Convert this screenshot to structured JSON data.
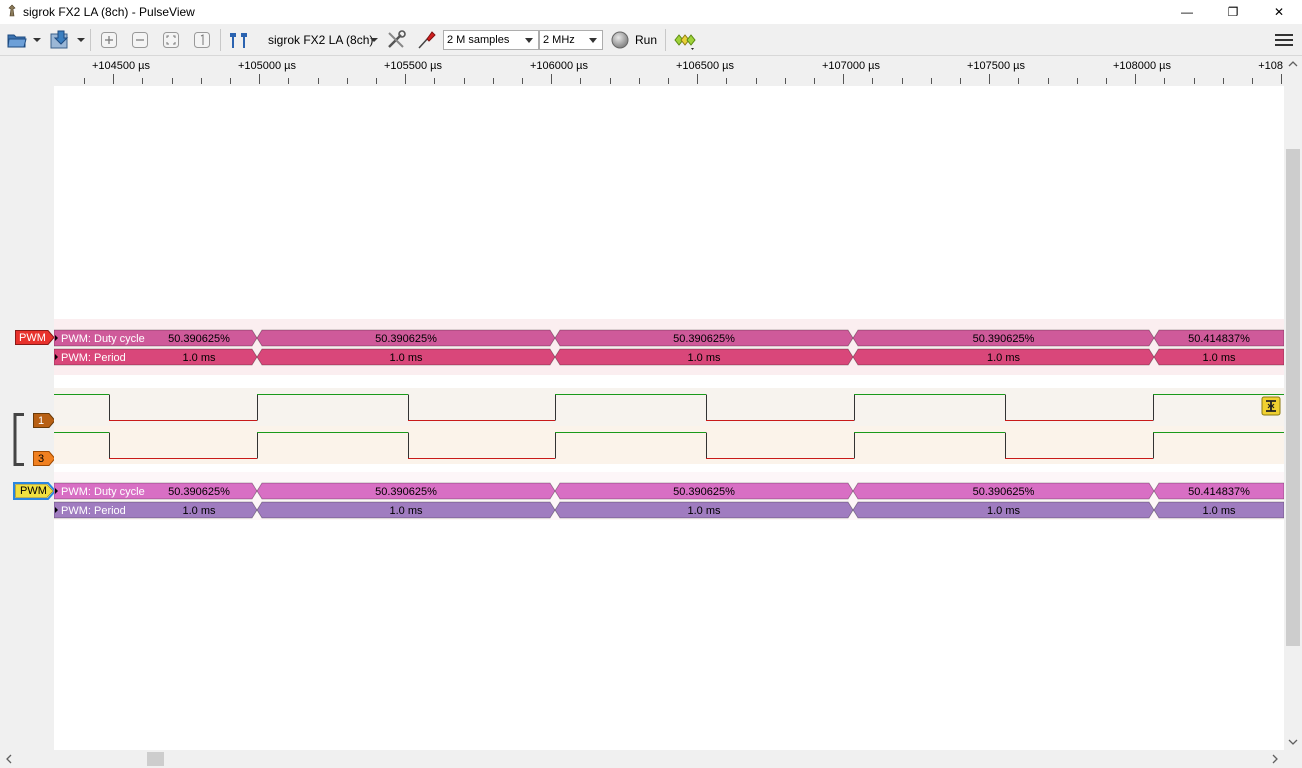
{
  "window": {
    "title": "sigrok FX2 LA (8ch) - PulseView",
    "minimize": "—",
    "maximize": "❐",
    "close": "✕"
  },
  "toolbar": {
    "device": "sigrok FX2 LA (8ch)",
    "samples": "2 M samples",
    "samplerate": "2 MHz",
    "run_label": "Run"
  },
  "ruler": {
    "labels": [
      "+104500 µs",
      "+105000 µs",
      "+105500 µs",
      "+106000 µs",
      "+106500 µs",
      "+107000 µs",
      "+107500 µs",
      "+108000 µs",
      "+108"
    ]
  },
  "traces": {
    "decoder1": {
      "tag": "PWM",
      "tag_color": "#e8322c",
      "duty_row_label": "PWM: Duty cycle",
      "period_row_label": "PWM: Period",
      "duty_color": "#cf5a9a",
      "period_color": "#d9477a",
      "duty_values": [
        "50.390625%",
        "50.390625%",
        "50.390625%",
        "50.390625%",
        "50.414837%"
      ],
      "period_values": [
        "1.0 ms",
        "1.0 ms",
        "1.0 ms",
        "1.0 ms",
        "1.0 ms"
      ]
    },
    "channels": [
      {
        "tag": "1",
        "color": "#b86014"
      },
      {
        "tag": "3",
        "color": "#f08020"
      }
    ],
    "decoder2": {
      "tag": "PWM",
      "tag_color": "#f0e040",
      "duty_row_label": "PWM: Duty cycle",
      "period_row_label": "PWM: Period",
      "duty_color": "#d86fc4",
      "period_color": "#a07cc0",
      "duty_values": [
        "50.390625%",
        "50.390625%",
        "50.390625%",
        "50.390625%",
        "50.414837%"
      ],
      "period_values": [
        "1.0 ms",
        "1.0 ms",
        "1.0 ms",
        "1.0 ms",
        "1.0 ms"
      ]
    }
  }
}
